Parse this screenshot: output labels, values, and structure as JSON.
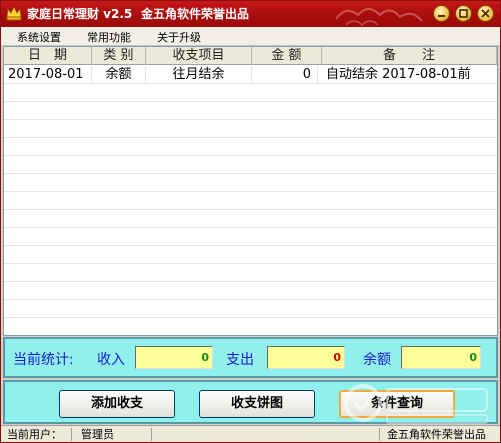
{
  "window": {
    "title": "家庭日常理财 v2.5",
    "subtitle": "金五角软件荣誉出品"
  },
  "menu": {
    "items": [
      "系统设置",
      "常用功能",
      "关于升级"
    ]
  },
  "table": {
    "columns": [
      "日　期",
      "类 别",
      "收支项目",
      "金 额",
      "备　　注"
    ],
    "rows": [
      [
        "2017-08-01",
        "余额",
        "往月结余",
        "0",
        "自动结余 2017-08-01前"
      ]
    ]
  },
  "stats": {
    "label": "当前统计:",
    "income_label": "收入",
    "income_value": "0",
    "expense_label": "支出",
    "expense_value": "0",
    "balance_label": "余额",
    "balance_value": "0"
  },
  "buttons": {
    "add": "添加收支",
    "pie": "收支饼图",
    "query": "条件查询"
  },
  "status": {
    "user_label": "当前用户：",
    "user": "管理员",
    "brand": "金五角软件荣誉出品"
  },
  "colors": {
    "title_bar": "#b01010",
    "panel": "#8ff0ec",
    "stat_value_bg": "#ffff99",
    "stat_income": "#1a8a1a",
    "stat_expense": "#cc0000",
    "stat_balance": "#1a8a1a"
  }
}
